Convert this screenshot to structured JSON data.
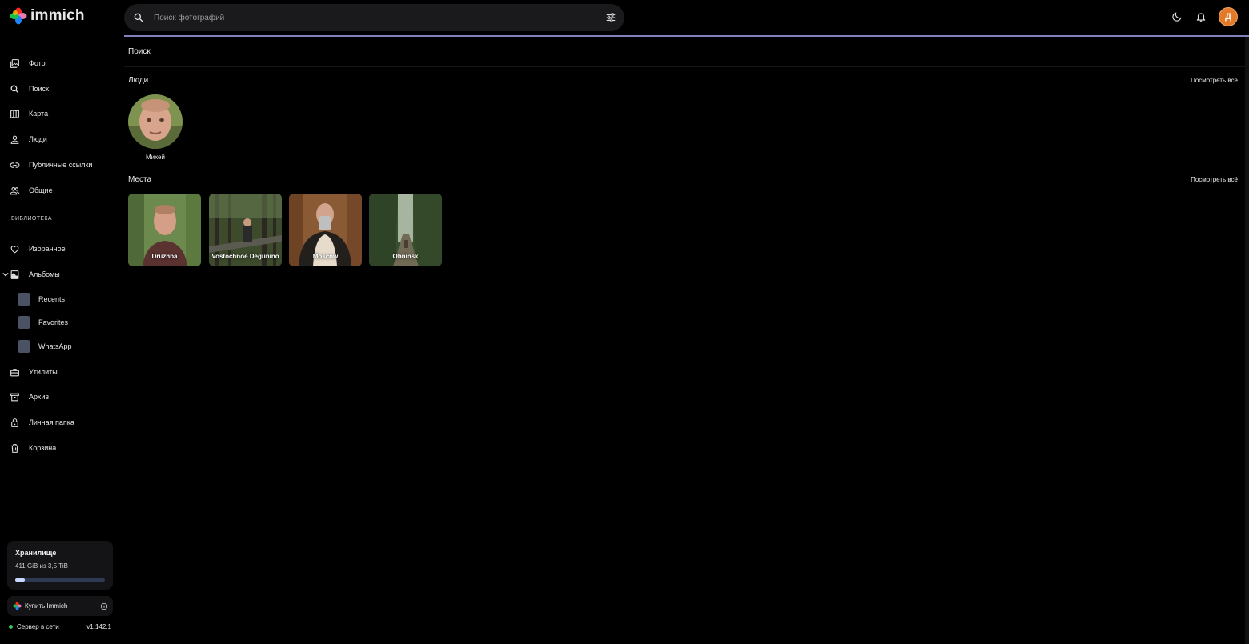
{
  "app": {
    "name": "immich"
  },
  "search": {
    "placeholder": "Поиск фотографий"
  },
  "user": {
    "initial": "Д"
  },
  "sidebar": {
    "items": [
      {
        "label": "Фото",
        "icon": "photos-icon"
      },
      {
        "label": "Поиск",
        "icon": "search-icon"
      },
      {
        "label": "Карта",
        "icon": "map-icon"
      },
      {
        "label": "Люди",
        "icon": "person-icon"
      },
      {
        "label": "Публичные ссылки",
        "icon": "link-icon"
      },
      {
        "label": "Общие",
        "icon": "shared-icon"
      }
    ],
    "library_label": "БИБЛИОТЕКА",
    "library_items": [
      {
        "label": "Избранное",
        "icon": "heart-icon"
      },
      {
        "label": "Альбомы",
        "icon": "album-icon"
      }
    ],
    "albums": [
      "Recents",
      "Favorites",
      "WhatsApp"
    ],
    "tools": [
      {
        "label": "Утилиты",
        "icon": "toolbox-icon"
      },
      {
        "label": "Архив",
        "icon": "archive-icon"
      },
      {
        "label": "Личная папка",
        "icon": "lock-icon"
      },
      {
        "label": "Корзина",
        "icon": "trash-icon"
      }
    ],
    "storage": {
      "title": "Хранилище",
      "usage": "411 GiB из 3,5 TiB",
      "used_fraction": 0.11
    },
    "buy_label": "Купить Immich",
    "server_status": "Сервер в сети",
    "version": "v1.142.1"
  },
  "main": {
    "title": "Поиск",
    "people": {
      "title": "Люди",
      "view_all": "Посмотреть всё",
      "items": [
        {
          "name": "Михей"
        }
      ]
    },
    "places": {
      "title": "Места",
      "view_all": "Посмотреть всё",
      "items": [
        {
          "name": "Druzhba"
        },
        {
          "name": "Vostochnoe Degunino"
        },
        {
          "name": "Moscow"
        },
        {
          "name": "Obninsk"
        }
      ]
    }
  },
  "colors": {
    "accent": "#8e8fd1",
    "avatar": "#e27a2a",
    "online": "#3dbb57"
  }
}
